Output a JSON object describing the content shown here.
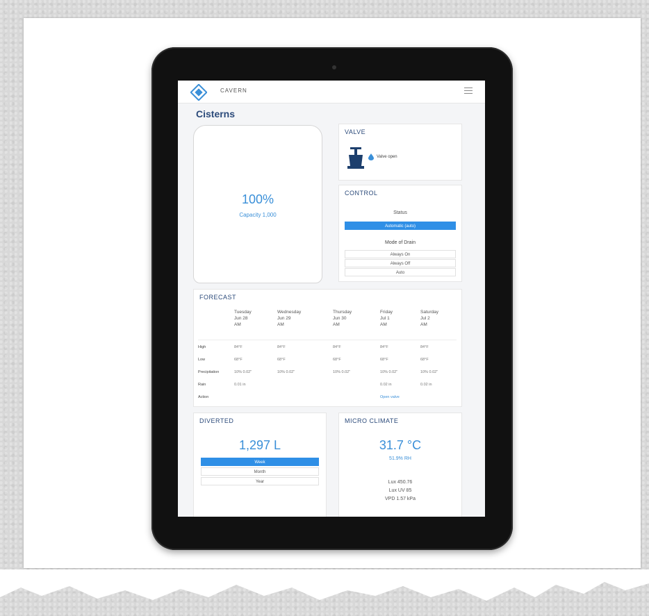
{
  "header": {
    "brand": "CAVERN"
  },
  "page": {
    "title": "Cisterns"
  },
  "cistern": {
    "percent": "100%",
    "subtitle": "Capacity 1,000"
  },
  "valve": {
    "title": "VALVE",
    "status_text": "Valve open"
  },
  "control": {
    "title": "CONTROL",
    "status_label": "Status",
    "active_option": "Automatic (auto)",
    "mode_label": "Mode of Drain",
    "options": [
      "Always On",
      "Always Off",
      "Auto"
    ]
  },
  "forecast": {
    "title": "FORECAST",
    "days": [
      {
        "day": "Tuesday",
        "date": "Jun 28",
        "tag": "AM"
      },
      {
        "day": "Wednesday",
        "date": "Jun 29",
        "tag": "AM"
      },
      {
        "day": "Thursday",
        "date": "Jun 30",
        "tag": "AM"
      },
      {
        "day": "Friday",
        "date": "Jul 1",
        "tag": "AM"
      },
      {
        "day": "Saturday",
        "date": "Jul 2",
        "tag": "AM"
      }
    ],
    "rows": [
      {
        "label": "High",
        "values": [
          "84°F",
          "84°F",
          "84°F",
          "84°F",
          "84°F"
        ]
      },
      {
        "label": "Low",
        "values": [
          "68°F",
          "68°F",
          "68°F",
          "68°F",
          "68°F"
        ]
      },
      {
        "label": "Precipitation",
        "values": [
          "10% 0.02\"",
          "10% 0.02\"",
          "10% 0.02\"",
          "10% 0.02\"",
          "10% 0.02\""
        ]
      },
      {
        "label": "Rain",
        "values": [
          "0.01 in",
          "",
          "",
          "0.02 in",
          "0.02 in"
        ]
      },
      {
        "label": "Action",
        "values": [
          "",
          "",
          "",
          "Open valve",
          ""
        ]
      }
    ]
  },
  "diverted": {
    "title": "DIVERTED",
    "value": "1,297 L",
    "active_option": "Week",
    "options": [
      "Month",
      "Year"
    ]
  },
  "micro_climate": {
    "title": "MICRO CLIMATE",
    "temperature": "31.7 °C",
    "humidity": "51.9% RH",
    "lines": [
      "Lux 450.76",
      "Lux UV 85",
      "VPD 1.57 kPa"
    ]
  }
}
